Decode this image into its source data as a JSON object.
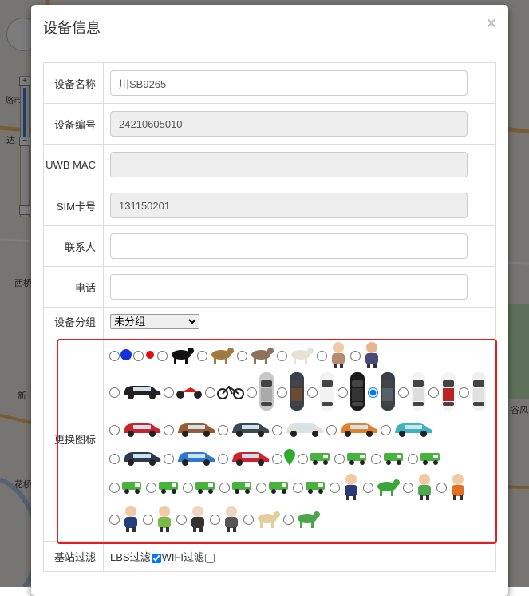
{
  "map": {
    "labels": [
      "赂市",
      "达",
      "西桥",
      "新",
      "花桥",
      "谷风"
    ],
    "zoom_in": "+",
    "zoom_out": "−"
  },
  "modal": {
    "title": "设备信息",
    "close": "×"
  },
  "form": {
    "device_name": {
      "label": "设备名称",
      "value": "川SB9265"
    },
    "device_no": {
      "label": "设备编号",
      "value": "24210605010"
    },
    "uwb_mac": {
      "label": "UWB MAC",
      "value": ""
    },
    "sim_no": {
      "label": "SIM卡号",
      "value": "131150201"
    },
    "contact": {
      "label": "联系人",
      "value": ""
    },
    "phone": {
      "label": "电话",
      "value": ""
    },
    "group": {
      "label": "设备分组",
      "selected": "未分组"
    },
    "icon": {
      "label": "更换图标"
    },
    "filter": {
      "label": "基站过滤",
      "lbs": "LBS过滤",
      "wifi": "WIFI过滤",
      "lbs_checked": true,
      "wifi_checked": false
    }
  },
  "icon_rows": [
    [
      "blue-dot",
      "red-dot",
      "black-bull",
      "horse",
      "goat",
      "dog",
      "elderly-couple",
      "girl-waving"
    ],
    [
      "black-suv",
      "red-motorcycle",
      "bicycle",
      "silver-car-top",
      "dark-car-top",
      "white-van-top",
      "black-car-top",
      "dark-suv-top",
      "white-car-top",
      "white-red-car-top",
      "white-car-top-2"
    ],
    [
      "red-mini-car",
      "brown-mini-car",
      "dark-mini-car",
      "white-mini-car",
      "orange-mini-car",
      "teal-convertible"
    ],
    [
      "dark-blue-mini-car",
      "blue-mini-car",
      "red-mini-car-2",
      "green-pin",
      "green-truck",
      "green-car",
      "green-bus",
      "green-lorry"
    ],
    [
      "green-atv",
      "green-ship",
      "green-mixer",
      "green-train",
      "green-police-car",
      "green-tractor",
      "businessman",
      "green-dog",
      "boy-running",
      "girl"
    ],
    [
      "police-officer",
      "worker",
      "old-man-hat",
      "old-man-glasses",
      "pug",
      "green-cat"
    ]
  ],
  "selected_icon": "dark-suv-top"
}
